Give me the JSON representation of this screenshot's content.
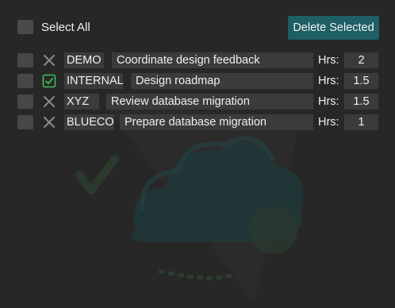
{
  "header": {
    "select_all_label": "Select All",
    "delete_selected_label": "Delete Selected"
  },
  "colors": {
    "accent_button": "#1d5f64",
    "done_check": "#3fbf5a",
    "not_done_x": "#8a8a8a"
  },
  "rows": [
    {
      "client": "DEMO",
      "task": "Coordinate design feedback",
      "hrs_label": "Hrs:",
      "hours": "2",
      "status_icon": "x-icon",
      "selected": false
    },
    {
      "client": "INTERNAL",
      "task": "Design roadmap",
      "hrs_label": "Hrs:",
      "hours": "1.5",
      "status_icon": "check-icon",
      "selected": false
    },
    {
      "client": "XYZ",
      "task": "Review database migration",
      "hrs_label": "Hrs:",
      "hours": "1.5",
      "status_icon": "x-icon",
      "selected": false
    },
    {
      "client": "BLUECO",
      "task": "Prepare database migration",
      "hrs_label": "Hrs:",
      "hours": "1",
      "status_icon": "x-icon",
      "selected": false
    }
  ]
}
